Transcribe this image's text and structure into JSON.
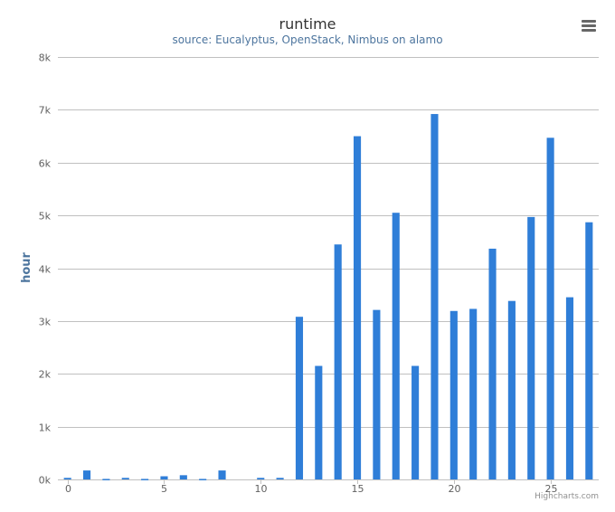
{
  "chart_data": {
    "type": "bar",
    "title": "runtime",
    "subtitle": "source: Eucalyptus, OpenStack, Nimbus on alamo",
    "xlabel": "",
    "ylabel": "hour",
    "x": [
      0,
      1,
      2,
      3,
      4,
      5,
      6,
      7,
      8,
      9,
      10,
      11,
      12,
      13,
      14,
      15,
      16,
      17,
      18,
      19,
      20,
      21,
      22,
      23,
      24,
      25,
      26,
      27
    ],
    "values": [
      30,
      170,
      10,
      30,
      10,
      60,
      80,
      10,
      170,
      0,
      30,
      30,
      3080,
      2150,
      4450,
      6500,
      3210,
      5050,
      2150,
      6920,
      3190,
      3230,
      4370,
      3380,
      4970,
      6470,
      3450,
      4870
    ],
    "xlim": [
      -0.5,
      27.5
    ],
    "ylim": [
      0,
      8000
    ],
    "x_ticks": [
      0,
      5,
      10,
      15,
      20,
      25
    ],
    "y_ticks": [
      0,
      1000,
      2000,
      3000,
      4000,
      5000,
      6000,
      7000,
      8000
    ],
    "y_tick_labels": [
      "0k",
      "1k",
      "2k",
      "3k",
      "4k",
      "5k",
      "6k",
      "7k",
      "8k"
    ],
    "grid": true,
    "bar_color": "#2f7ed8",
    "gridline_color": "#c0c0c0",
    "axis_label_color": "#4d759e",
    "credits": "Highcharts.com"
  }
}
